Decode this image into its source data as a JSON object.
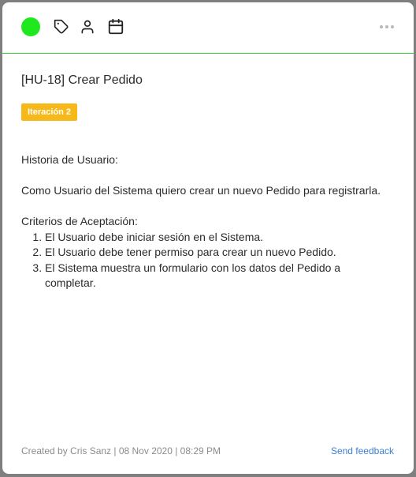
{
  "toolbar": {
    "status_color": "#1fe81f",
    "icons": [
      "tag-icon",
      "user-icon",
      "calendar-icon"
    ],
    "more_icon": "more-horizontal-icon",
    "divider_color": "#3fcc3f"
  },
  "card": {
    "title": "[HU-18] Crear Pedido",
    "badge": {
      "label": "Iteración 2",
      "color": "#f7b81a"
    },
    "description": {
      "heading": "Historia de Usuario:",
      "story": "Como Usuario del Sistema quiero crear un nuevo Pedido para registrarla.",
      "criteria_heading": "Criterios de Aceptación:",
      "criteria": [
        "El Usuario debe iniciar sesión en el Sistema.",
        "El Usuario debe tener permiso para crear un nuevo Pedido.",
        "El Sistema muestra un formulario con los datos del Pedido a completar."
      ]
    }
  },
  "footer": {
    "meta": "Created by Cris Sanz | 08 Nov 2020 | 08:29 PM",
    "feedback_label": "Send feedback",
    "link_color": "#3b7fd4"
  }
}
